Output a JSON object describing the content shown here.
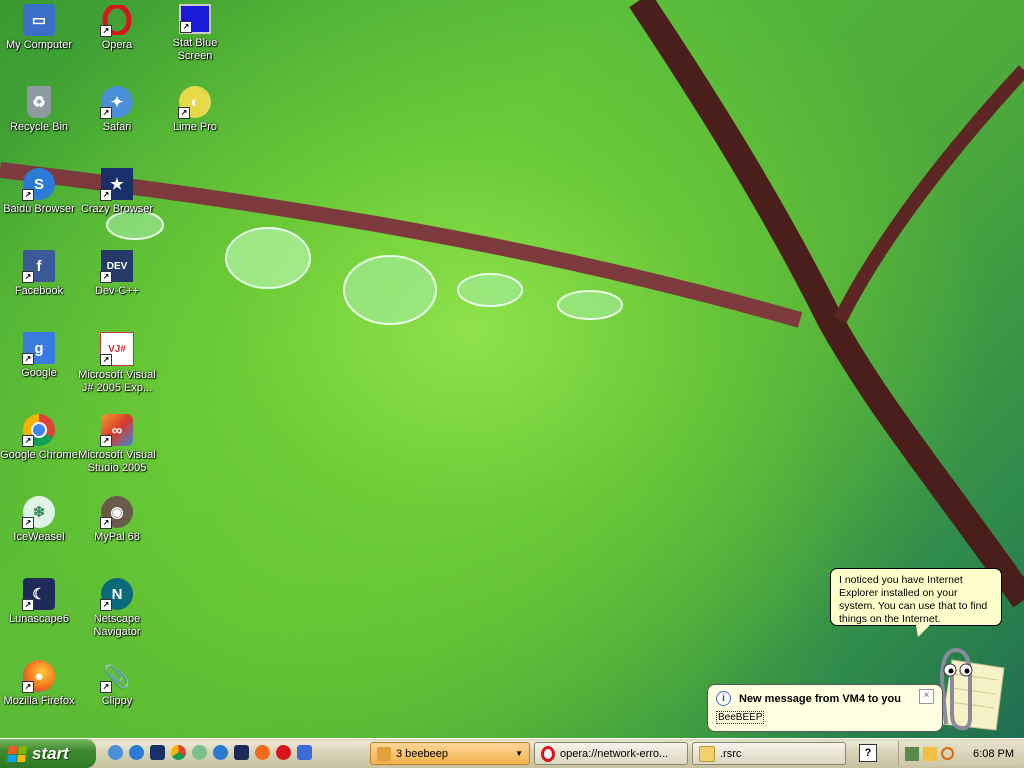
{
  "desktop": {
    "icons": [
      {
        "label": "My Computer"
      },
      {
        "label": "Opera"
      },
      {
        "label": "Stat Blue Screen"
      },
      {
        "label": "Recycle Bin"
      },
      {
        "label": "Safari"
      },
      {
        "label": "Lime Pro"
      },
      {
        "label": "Baidu Browser"
      },
      {
        "label": "Crazy Browser"
      },
      {
        "label": "Facebook"
      },
      {
        "label": "Dev-C++"
      },
      {
        "label": "Google"
      },
      {
        "label": "Microsoft Visual J# 2005 Exp..."
      },
      {
        "label": "Google Chrome"
      },
      {
        "label": "Microsoft Visual Studio 2005"
      },
      {
        "label": "IceWeasel"
      },
      {
        "label": "MyPal 68"
      },
      {
        "label": "Lunascape6"
      },
      {
        "label": "Netscape Navigator"
      },
      {
        "label": "Mozilla Firefox"
      },
      {
        "label": "Clippy"
      }
    ]
  },
  "assistant": {
    "message": "I noticed you have Internet Explorer installed on your system. You can use that to find things on the Internet."
  },
  "notification": {
    "title": "New message from VM4 to you",
    "body": "BeeBEEP",
    "close": "×"
  },
  "taskbar": {
    "start_label": "start",
    "tasks": [
      {
        "label": "3 beebeep",
        "caret": "▼"
      },
      {
        "label": "opera://network-erro..."
      },
      {
        "label": ".rsrc"
      }
    ],
    "help_label": "?",
    "clock": "6:08 PM"
  },
  "colors": {
    "start_green": "#3e8a2f",
    "taskbar": "#d6d1b3",
    "balloon": "#ffffcc"
  }
}
